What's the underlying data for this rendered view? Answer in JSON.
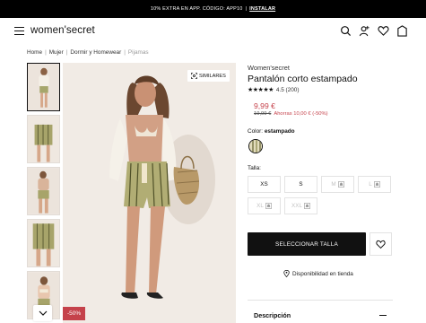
{
  "promo": {
    "text": "10% EXTRA EN APP. CÓDIGO: APP10",
    "separator": "|",
    "link": "INSTALAR"
  },
  "header": {
    "logo": "women'secret",
    "icons": [
      "menu-icon",
      "search-icon",
      "account-icon",
      "wishlist-icon",
      "bag-icon"
    ]
  },
  "breadcrumb": [
    {
      "label": "Home"
    },
    {
      "label": "Mujer"
    },
    {
      "label": "Dormir y Homewear"
    },
    {
      "label": "Pijamas"
    }
  ],
  "breadcrumb_separator": "|",
  "gallery": {
    "similar_label": "SIMILARES",
    "discount_badge": "-50%",
    "thumbnail_count": 5
  },
  "product": {
    "brand": "Women'secret",
    "title": "Pantalón corto estampado",
    "stars": "★★★★★",
    "rating": "4.5 (200)",
    "price": "9,99 €",
    "old_price": "19,99 €",
    "savings": "Ahorras 10,00 € (-50%)",
    "color_label": "Color:",
    "color_value": "estampado",
    "size_label": "Talla:",
    "sizes": [
      {
        "label": "XS",
        "available": true
      },
      {
        "label": "S",
        "available": true
      },
      {
        "label": "M",
        "available": false
      },
      {
        "label": "L",
        "available": false
      },
      {
        "label": "XL",
        "available": false
      },
      {
        "label": "XXL",
        "available": false
      }
    ],
    "select_size_button": "SELECCIONAR TALLA",
    "store_availability": "Disponibilidad en tienda",
    "description_label": "Descripción"
  },
  "colors": {
    "promo_bg": "#000000",
    "accent_red": "#c5424b",
    "button_bg": "#111111"
  }
}
